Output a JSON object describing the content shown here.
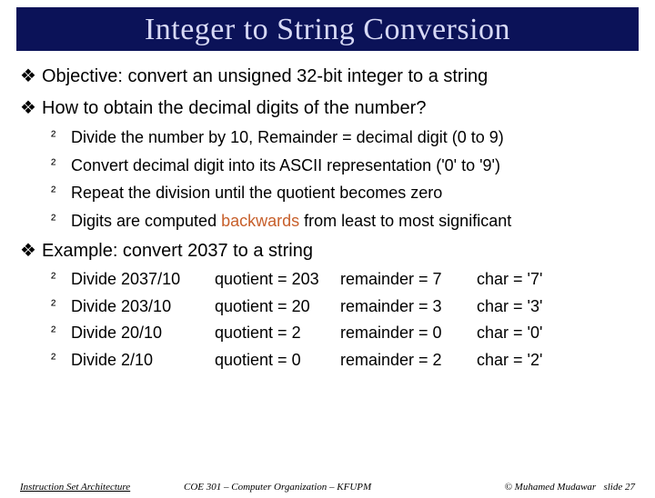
{
  "title": "Integer to String Conversion",
  "bullets": {
    "objective": "Objective: convert an unsigned 32-bit integer to a string",
    "how": "How to obtain the decimal digits of the number?",
    "how_sub": [
      "Divide the number by 10, Remainder = decimal digit (0 to 9)",
      "Convert decimal digit into its ASCII representation ('0' to '9')",
      "Repeat the division until the quotient becomes zero"
    ],
    "how_sub_emph_pre": "Digits are computed ",
    "how_sub_emph_word": "backwards",
    "how_sub_emph_post": " from least to most significant",
    "example": "Example: convert 2037 to a string"
  },
  "example_rows": [
    {
      "div": "Divide 2037/10",
      "quot": "quotient = 203",
      "rem": "remainder = 7",
      "ch": "char = '7'"
    },
    {
      "div": "Divide 203/10",
      "quot": "quotient = 20",
      "rem": "remainder = 3",
      "ch": "char = '3'"
    },
    {
      "div": "Divide 20/10",
      "quot": "quotient = 2",
      "rem": "remainder = 0",
      "ch": "char = '0'"
    },
    {
      "div": "Divide 2/10",
      "quot": "quotient = 0",
      "rem": "remainder = 2",
      "ch": "char = '2'"
    }
  ],
  "footer": {
    "left": "Instruction Set Architecture",
    "center": "COE 301 – Computer Organization – KFUPM",
    "right_author": "© Muhamed Mudawar",
    "right_slide": "slide 27"
  },
  "glyphs": {
    "l1": "❖",
    "l2": "²"
  }
}
